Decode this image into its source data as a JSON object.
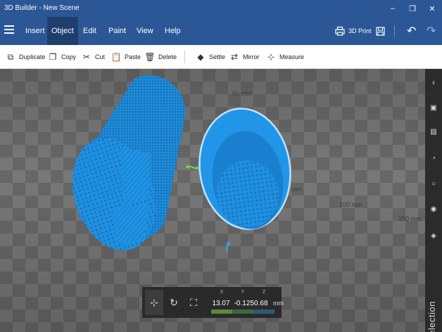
{
  "window": {
    "title": "3D Builder - New Scene"
  },
  "menu": {
    "items": [
      {
        "label": "Insert"
      },
      {
        "label": "Object",
        "active": true
      },
      {
        "label": "Edit"
      },
      {
        "label": "Paint"
      },
      {
        "label": "View"
      },
      {
        "label": "Help"
      }
    ],
    "print_label": "3D Print"
  },
  "toolbar": {
    "duplicate": "Duplicate",
    "copy": "Copy",
    "cut": "Cut",
    "paste": "Paste",
    "delete": "Delete",
    "settle": "Settle",
    "mirror": "Mirror",
    "measure": "Measure"
  },
  "viewport": {
    "scale_labels": [
      "50 mm",
      "mm",
      "100 mm",
      "150 mm"
    ],
    "object_color": "#1f8fdf"
  },
  "sidepanel": {
    "label": "Selection"
  },
  "position": {
    "x_label": "X",
    "y_label": "Y",
    "z_label": "Z",
    "x": "13.07",
    "y": "-0.12",
    "z": "50.68",
    "unit": "mm",
    "x_color": "#5a8a3a",
    "y_color": "#3a6a3a",
    "z_color": "#2d5a7a"
  }
}
